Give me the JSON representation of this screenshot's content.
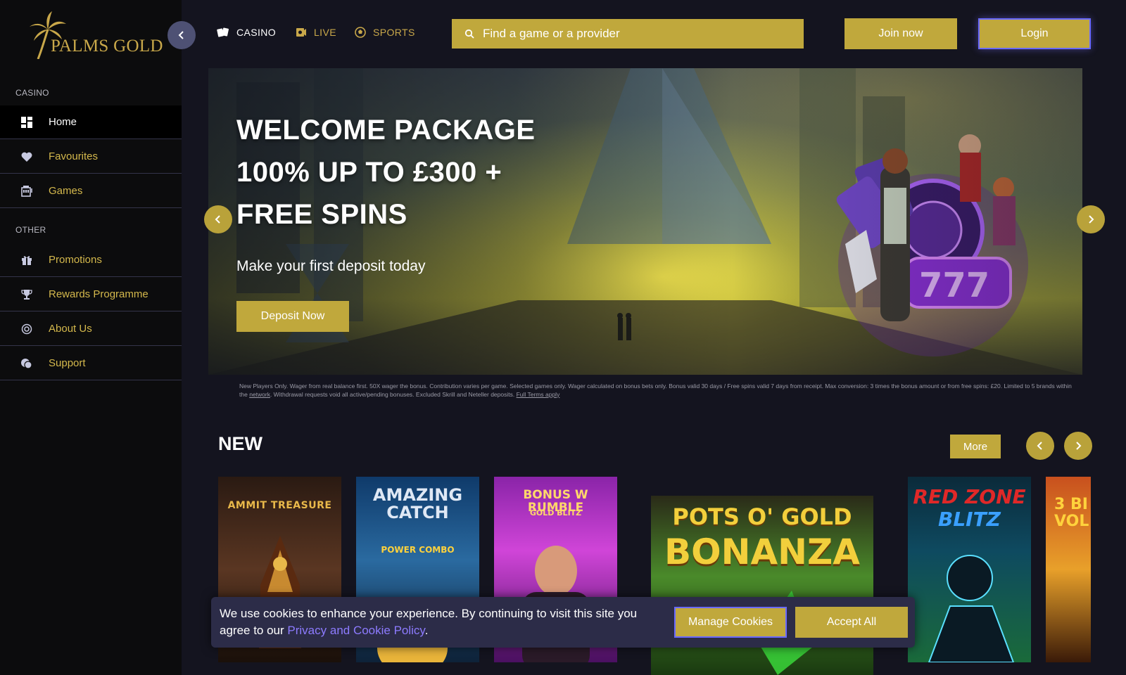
{
  "brand": {
    "name": "PALMS GOLD"
  },
  "sidebar": {
    "casino_label": "CASINO",
    "other_label": "OTHER",
    "casino_items": [
      {
        "label": "Home",
        "icon": "grid-icon",
        "active": true
      },
      {
        "label": "Favourites",
        "icon": "heart-icon"
      },
      {
        "label": "Games",
        "icon": "slot-machine-icon"
      }
    ],
    "other_items": [
      {
        "label": "Promotions",
        "icon": "gift-icon"
      },
      {
        "label": "Rewards Programme",
        "icon": "trophy-icon"
      },
      {
        "label": "About Us",
        "icon": "info-circle-icon"
      },
      {
        "label": "Support",
        "icon": "chat-icon"
      }
    ]
  },
  "header": {
    "nav": [
      {
        "label": "CASINO",
        "icon": "cards-icon"
      },
      {
        "label": "LIVE",
        "icon": "live-dealer-icon"
      },
      {
        "label": "SPORTS",
        "icon": "football-icon"
      }
    ],
    "search_placeholder": "Find a game or a provider",
    "join_label": "Join now",
    "login_label": "Login"
  },
  "hero": {
    "line1": "WELCOME PACKAGE",
    "line2": "100% UP TO £300 +",
    "line3": "FREE SPINS",
    "subtitle": "Make your first deposit today",
    "cta": "Deposit Now",
    "terms_part1": "New Players Only. Wager from real balance first. 50X wager the bonus. Contribution varies per game. Selected games only. Wager calculated on bonus bets only. Bonus valid 30 days / Free spins valid 7 days from receipt. Max conversion: 3 times the bonus amount or from free spins: £20. Limited to 5 brands within the ",
    "terms_link1": "network",
    "terms_part2": ". Withdrawal requests void all active/pending bonuses. Excluded Skrill and Neteller deposits. ",
    "terms_link2": "Full Terms apply"
  },
  "new_section": {
    "title": "NEW",
    "more_label": "More",
    "games": [
      {
        "name": "AMMIT TREASURE",
        "bg": "#3a2418",
        "text_color": "#e8b84a"
      },
      {
        "name": "AMAZING CATCH",
        "sub": "POWER COMBO",
        "bg": "#1e4a7a",
        "text_color": "#dfe8f5"
      },
      {
        "name": "BONUS W RUMBLE",
        "sub": "GOLD BLITZ",
        "bg": "#b23cc0",
        "text_color": "#ffd86a"
      },
      {
        "name": "POTS O' GOLD",
        "sub": "BONANZA",
        "bg": "#203a10",
        "text_color": "#f2cf3c"
      },
      {
        "name": "RED ZONE",
        "sub": "BLITZ",
        "bg": "#0b2a3a",
        "text_color": "#e02828"
      },
      {
        "name": "3 BI",
        "sub": "VOL",
        "bg": "#c8501e",
        "text_color": "#ffd23c"
      }
    ]
  },
  "cookie": {
    "text_before": "We use cookies to enhance your experience. By continuing to visit this site you agree to our ",
    "link": "Privacy and Cookie Policy",
    "text_after": ".",
    "manage_label": "Manage Cookies",
    "accept_label": "Accept All"
  },
  "colors": {
    "gold": "#c0a83c",
    "page_bg": "#14141f",
    "sidebar_bg": "#0c0c0d",
    "cookie_bg": "#2c2c48",
    "link_purple": "#8d7bff"
  }
}
